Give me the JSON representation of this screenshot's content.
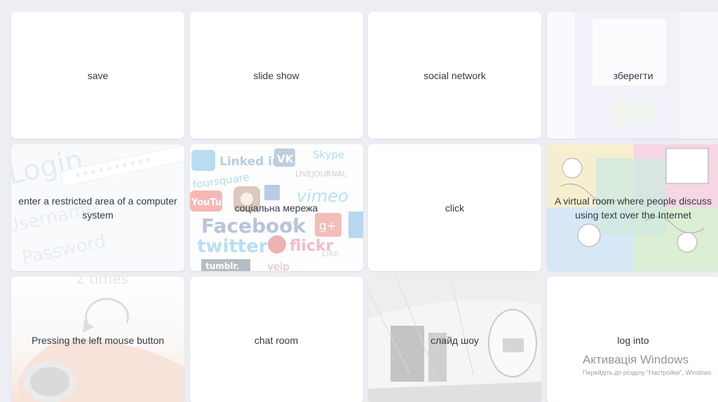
{
  "cards": [
    {
      "label": "save"
    },
    {
      "label": "slide show"
    },
    {
      "label": "social network"
    },
    {
      "label": "зберегти"
    },
    {
      "label": "enter a restricted area of a computer system"
    },
    {
      "label": "соціальна мережа"
    },
    {
      "label": "click"
    },
    {
      "label": "A virtual room where people discuss using text over the Internet"
    },
    {
      "label": "Pressing the left mouse button"
    },
    {
      "label": "chat room"
    },
    {
      "label": "слайд шоу"
    },
    {
      "label": "log into"
    }
  ],
  "card_images": {
    "login": {
      "words": [
        "Login",
        "Username",
        "Password"
      ]
    },
    "social": {
      "words": [
        "Linked in",
        "VK",
        "Skype",
        "foursquare",
        "LIVEJOURNAL",
        "YouTube",
        "vimeo",
        "Facebook",
        "g+",
        "my",
        "flickr",
        "twitter",
        "tumblr.",
        "yelp",
        "Like"
      ]
    },
    "mouse": {
      "words": [
        "2 times"
      ]
    }
  },
  "watermark": {
    "title": "Активація Windows",
    "subtitle": "Перейдіть до розділу \"Настройки\", Windows."
  }
}
